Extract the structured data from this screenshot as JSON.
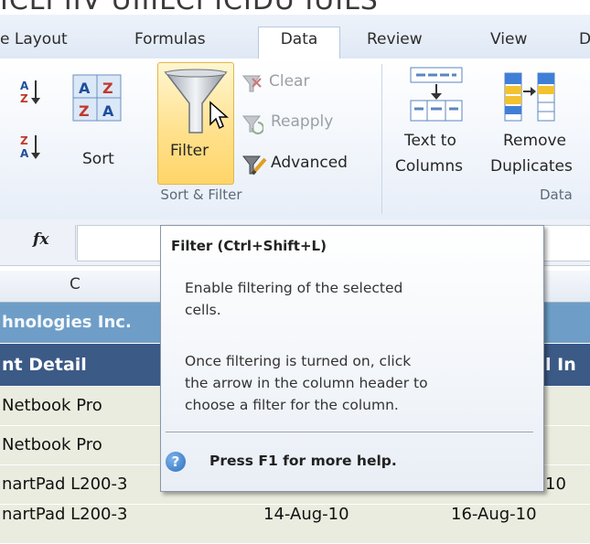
{
  "window": {
    "title_fragment": "ICLI IIV UIIILCI ICIDU IUILS"
  },
  "tabs": [
    {
      "label": "e Layout",
      "active": false
    },
    {
      "label": "Formulas",
      "active": false
    },
    {
      "label": "Data",
      "active": true
    },
    {
      "label": "Review",
      "active": false
    },
    {
      "label": "View",
      "active": false
    },
    {
      "label": "D",
      "active": false
    }
  ],
  "ribbon": {
    "sort_filter": {
      "group_label": "Sort & Filter",
      "sort_label": "Sort",
      "filter_label": "Filter",
      "clear_label": "Clear",
      "reapply_label": "Reapply",
      "advanced_label": "Advanced"
    },
    "data_tools": {
      "text_to_columns_line1": "Text to",
      "text_to_columns_line2": "Columns",
      "remove_duplicates_line1": "Remove",
      "remove_duplicates_line2": "Duplicates",
      "group_label": "Data"
    }
  },
  "formula_bar": {
    "fx_label": "fx",
    "value": ""
  },
  "sheet": {
    "column_header": "C",
    "company_text": "hnologies Inc.",
    "headers": [
      "nt Detail",
      "l In"
    ],
    "rows": [
      {
        "product": "Netbook Pro",
        "date1": "",
        "date2": ""
      },
      {
        "product": "Netbook Pro",
        "date1": "",
        "date2": ""
      },
      {
        "product": "nartPad L200-3",
        "date1": "",
        "date2": "10"
      },
      {
        "product": "nartPad L200-3",
        "date1": "14-Aug-10",
        "date2": "16-Aug-10"
      }
    ]
  },
  "tooltip": {
    "title": "Filter (Ctrl+Shift+L)",
    "lines": [
      "Enable filtering of the selected",
      "cells.",
      "Once filtering is turned on, click",
      "the arrow in the column header to",
      "choose a filter for the column."
    ],
    "help_text": "Press F1 for more help."
  },
  "colors": {
    "company_band": "#6e9ec7",
    "header_band": "#3b5a86",
    "row_fill": "#e9ecde",
    "filter_highlight": "#ffe08a"
  },
  "icons": [
    "sort-ascending-icon",
    "sort-dialog-icon",
    "sort-descending-icon",
    "filter-funnel-icon",
    "clear-filter-icon",
    "reapply-icon",
    "advanced-filter-icon",
    "text-to-columns-icon",
    "remove-duplicates-icon",
    "help-icon",
    "mouse-cursor-icon"
  ]
}
